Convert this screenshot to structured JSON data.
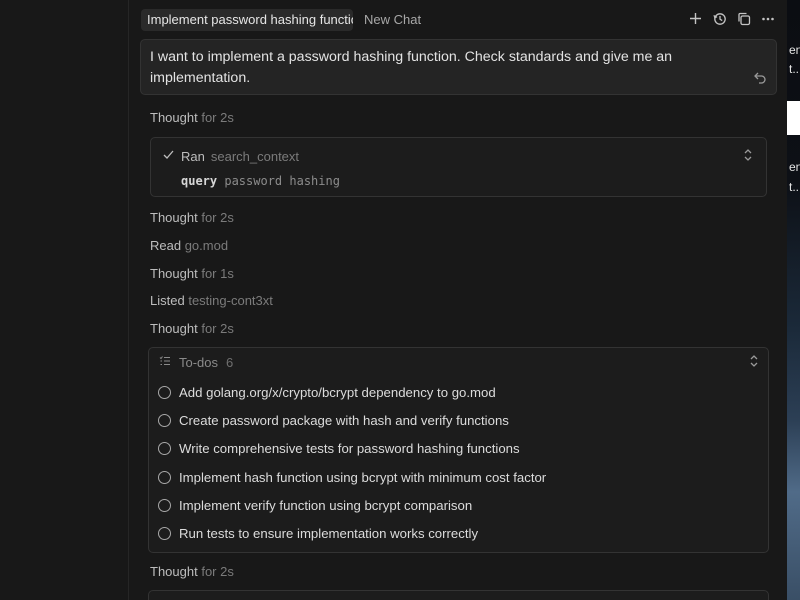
{
  "tabs": {
    "active_title": "Implement password hashing function",
    "new_chat_label": "New Chat"
  },
  "tab_actions": [
    {
      "icon": "plus-icon"
    },
    {
      "icon": "history-icon"
    },
    {
      "icon": "duplicate-icon"
    },
    {
      "icon": "more-icon"
    }
  ],
  "user_message": {
    "text": "I want to implement a password hashing function. Check standards and give me an implementation."
  },
  "steps": {
    "thought1": {
      "label": "Thought",
      "detail": "for 2s"
    },
    "tool": {
      "status": "Ran",
      "name": "search_context",
      "param_key": "query",
      "param_value": "password hashing"
    },
    "thought2": {
      "label": "Thought",
      "detail": "for 2s"
    },
    "read": {
      "label": "Read",
      "detail": "go.mod"
    },
    "thought3": {
      "label": "Thought",
      "detail": "for 1s"
    },
    "listed": {
      "label": "Listed",
      "detail": "testing-cont3xt"
    },
    "thought4": {
      "label": "Thought",
      "detail": "for 2s"
    },
    "thought5": {
      "label": "Thought",
      "detail": "for 2s"
    }
  },
  "todos": {
    "title": "To-dos",
    "count": "6",
    "items": [
      "Add golang.org/x/crypto/bcrypt dependency to go.mod",
      "Create password package with hash and verify functions",
      "Write comprehensive tests for password hashing functions",
      "Implement hash function using bcrypt with minimum cost factor",
      "Implement verify function using bcrypt comparison",
      "Run tests to ensure implementation works correctly"
    ]
  },
  "background": {
    "peek_text_1": "en",
    "peek_text_2": "t..",
    "peek_text_3": "en",
    "peek_text_4": "t.."
  }
}
